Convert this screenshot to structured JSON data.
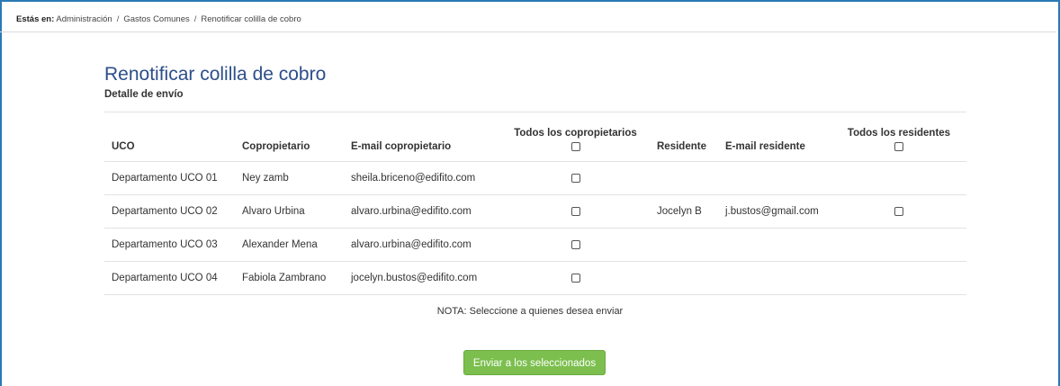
{
  "breadcrumb": {
    "lead": "Estás en:",
    "items": [
      "Administración",
      "Gastos Comunes",
      "Renotificar colilla de cobro"
    ],
    "separator": "/"
  },
  "page": {
    "title": "Renotificar colilla de cobro",
    "subtitle": "Detalle de envío"
  },
  "table": {
    "headers": {
      "uco": "UCO",
      "copropietario": "Copropietario",
      "email_copropietario": "E-mail copropietario",
      "todos_copropietarios": "Todos los copropietarios",
      "residente": "Residente",
      "email_residente": "E-mail residente",
      "todos_residentes": "Todos los residentes"
    },
    "rows": [
      {
        "uco": "Departamento UCO 01",
        "copropietario": "Ney zamb",
        "email_copropietario": "sheila.briceno@edifito.com",
        "residente": "",
        "email_residente": ""
      },
      {
        "uco": "Departamento UCO 02",
        "copropietario": "Alvaro Urbina",
        "email_copropietario": "alvaro.urbina@edifito.com",
        "residente": "Jocelyn B",
        "email_residente": "j.bustos@gmail.com"
      },
      {
        "uco": "Departamento UCO 03",
        "copropietario": "Alexander Mena",
        "email_copropietario": "alvaro.urbina@edifito.com",
        "residente": "",
        "email_residente": ""
      },
      {
        "uco": "Departamento UCO 04",
        "copropietario": "Fabiola Zambrano",
        "email_copropietario": "jocelyn.bustos@edifito.com",
        "residente": "",
        "email_residente": ""
      }
    ]
  },
  "note": "NOTA: Seleccione a quienes desea enviar",
  "actions": {
    "send_label": "Enviar a los seleccionados"
  },
  "colors": {
    "frame": "#2a7ab5",
    "title": "#2c4e8a",
    "button": "#7cbf4e"
  }
}
